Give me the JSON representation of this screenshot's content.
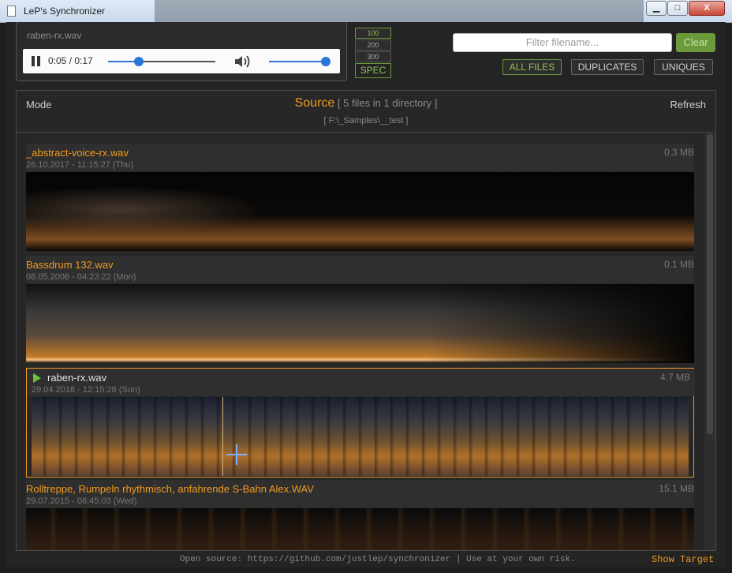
{
  "window": {
    "title": "LeP's Synchronizer",
    "minimize_label": "▁",
    "maximize_label": "□",
    "close_label": "X"
  },
  "player": {
    "filename": "raben-rx.wav",
    "time": "0:05 / 0:17",
    "progress_fraction": 0.29,
    "volume_fraction": 1.0
  },
  "size_buttons": [
    "100",
    "200",
    "300"
  ],
  "size_selected": "100",
  "spec_label": "SPEC",
  "filter": {
    "placeholder": "Filter filename...",
    "clear_label": "Clear"
  },
  "tabs": [
    {
      "label": "ALL FILES",
      "active": true
    },
    {
      "label": "DUPLICATES",
      "active": false
    },
    {
      "label": "UNIQUES",
      "active": false
    }
  ],
  "panel": {
    "mode_label": "Mode",
    "refresh_label": "Refresh",
    "title": "Source",
    "summary": "[ 5 files in 1 directory ]",
    "path": "[ F:\\_Samples\\__test ]"
  },
  "files": [
    {
      "name": "_abstract-voice-rx.wav",
      "date": "26.10.2017 - 11:15:27 (Thu)",
      "size": "0.3 MB",
      "playing": false
    },
    {
      "name": "Bassdrum 132.wav",
      "date": "08.05.2006 - 04:23:22 (Mon)",
      "size": "0.1 MB",
      "playing": false
    },
    {
      "name": "raben-rx.wav",
      "date": "29.04.2018 - 12:15:28 (Sun)",
      "size": "4.7 MB",
      "playing": true
    },
    {
      "name": "Rolltreppe, Rumpeln rhythmisch, anfahrende S-Bahn Alex.WAV",
      "date": "29.07.2015 - 08:45:03 (Wed)",
      "size": "15.1 MB",
      "playing": false
    }
  ],
  "footer": {
    "text": "Open source: https://github.com/justlep/synchronizer  |  Use at your own risk.",
    "show_target": "Show Target"
  },
  "colors": {
    "accent": "#f29a20",
    "green": "#6a9a3a",
    "blue": "#2a75d6"
  }
}
